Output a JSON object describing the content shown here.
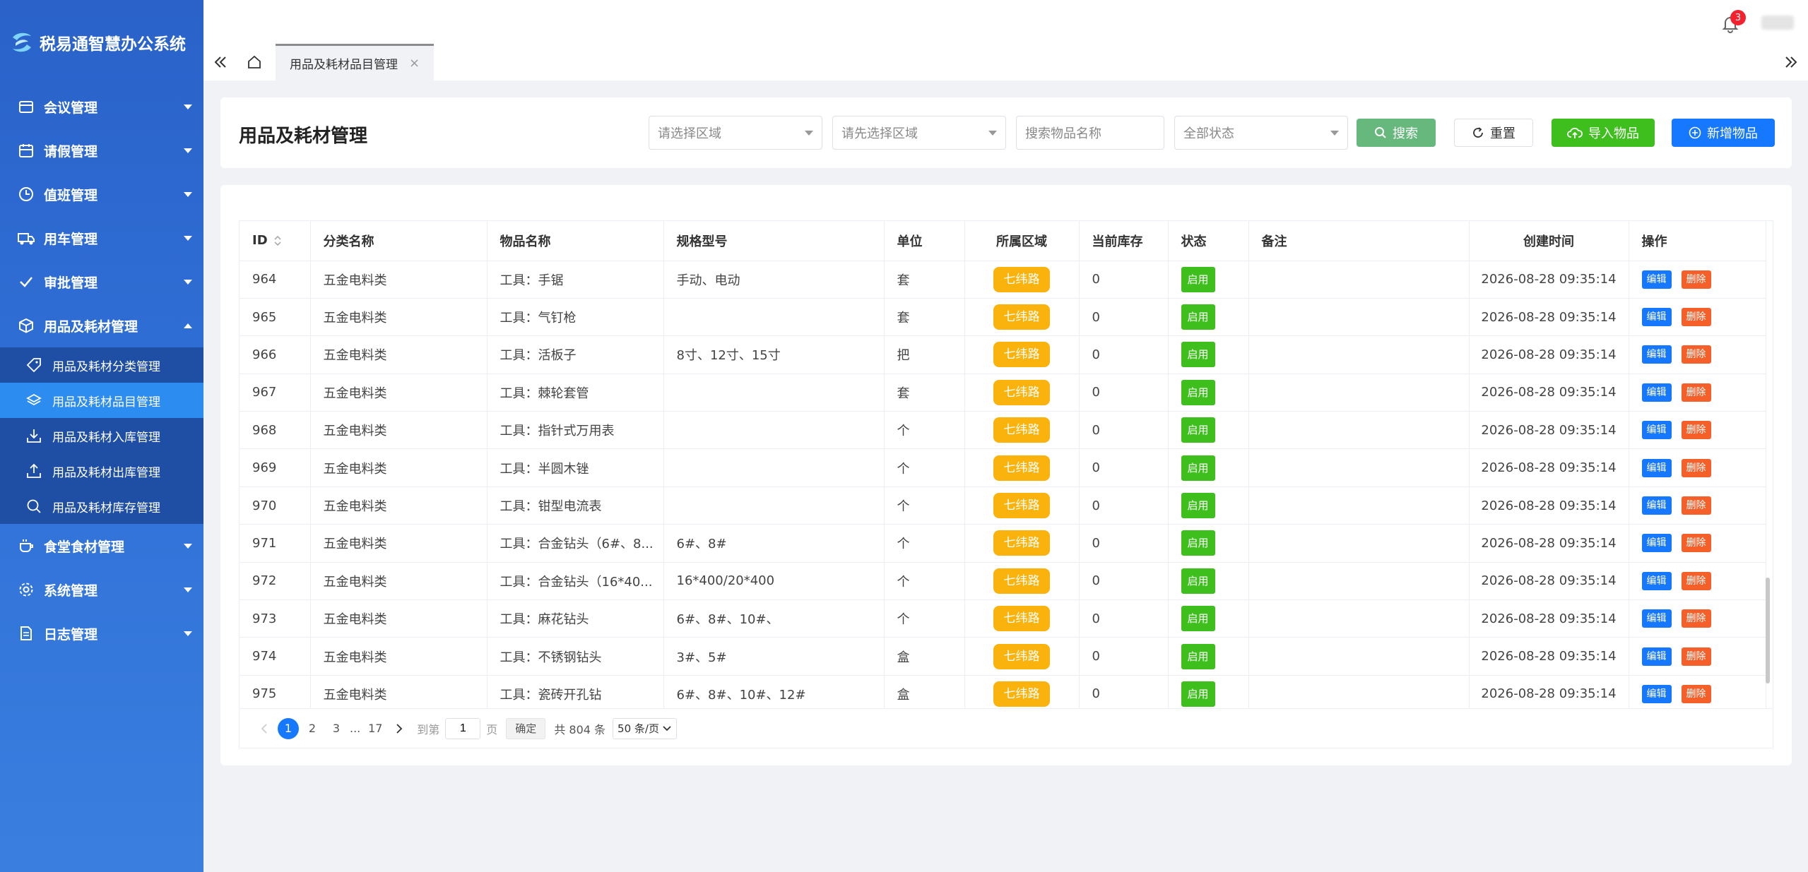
{
  "app": {
    "title": "税易通智慧办公系统"
  },
  "sidebar": {
    "items": [
      {
        "label": "会议管理",
        "icon": "calendar-icon"
      },
      {
        "label": "请假管理",
        "icon": "calendar-grid-icon"
      },
      {
        "label": "值班管理",
        "icon": "clock-icon"
      },
      {
        "label": "用车管理",
        "icon": "truck-icon"
      },
      {
        "label": "审批管理",
        "icon": "check-icon"
      },
      {
        "label": "用品及耗材管理",
        "icon": "box-icon"
      },
      {
        "label": "食堂食材管理",
        "icon": "cup-icon"
      },
      {
        "label": "系统管理",
        "icon": "gear-icon"
      },
      {
        "label": "日志管理",
        "icon": "document-icon"
      }
    ],
    "subitems": [
      {
        "label": "用品及耗材分类管理",
        "icon": "tag-icon"
      },
      {
        "label": "用品及耗材品目管理",
        "icon": "layers-icon"
      },
      {
        "label": "用品及耗材入库管理",
        "icon": "download-icon"
      },
      {
        "label": "用品及耗材出库管理",
        "icon": "upload-icon"
      },
      {
        "label": "用品及耗材库存管理",
        "icon": "search-icon"
      }
    ]
  },
  "header": {
    "notification_count": "3"
  },
  "tabs": [
    {
      "label": "用品及耗材品目管理"
    }
  ],
  "filters": {
    "page_title": "用品及耗材管理",
    "region1_placeholder": "请选择区域",
    "region2_placeholder": "请先选择区域",
    "search_placeholder": "搜索物品名称",
    "status_value": "全部状态",
    "search_label": "搜索",
    "reset_label": "重置",
    "import_label": "导入物品",
    "add_label": "新增物品"
  },
  "table": {
    "columns": [
      "ID",
      "分类名称",
      "物品名称",
      "规格型号",
      "单位",
      "所属区域",
      "当前库存",
      "状态",
      "备注",
      "创建时间",
      "操作"
    ],
    "edit_label": "编辑",
    "delete_label": "删除",
    "rows": [
      {
        "id": "964",
        "category": "五金电料类",
        "name": "工具：手锯",
        "spec": "手动、电动",
        "unit": "套",
        "area": "七纬路",
        "stock": "0",
        "status": "启用",
        "note": "",
        "created": "2026-08-28 09:35:14"
      },
      {
        "id": "965",
        "category": "五金电料类",
        "name": "工具：气钉枪",
        "spec": "",
        "unit": "套",
        "area": "七纬路",
        "stock": "0",
        "status": "启用",
        "note": "",
        "created": "2026-08-28 09:35:14"
      },
      {
        "id": "966",
        "category": "五金电料类",
        "name": "工具：活板子",
        "spec": "8寸、12寸、15寸",
        "unit": "把",
        "area": "七纬路",
        "stock": "0",
        "status": "启用",
        "note": "",
        "created": "2026-08-28 09:35:14"
      },
      {
        "id": "967",
        "category": "五金电料类",
        "name": "工具：棘轮套管",
        "spec": "",
        "unit": "套",
        "area": "七纬路",
        "stock": "0",
        "status": "启用",
        "note": "",
        "created": "2026-08-28 09:35:14"
      },
      {
        "id": "968",
        "category": "五金电料类",
        "name": "工具：指针式万用表",
        "spec": "",
        "unit": "个",
        "area": "七纬路",
        "stock": "0",
        "status": "启用",
        "note": "",
        "created": "2026-08-28 09:35:14"
      },
      {
        "id": "969",
        "category": "五金电料类",
        "name": "工具：半圆木锉",
        "spec": "",
        "unit": "个",
        "area": "七纬路",
        "stock": "0",
        "status": "启用",
        "note": "",
        "created": "2026-08-28 09:35:14"
      },
      {
        "id": "970",
        "category": "五金电料类",
        "name": "工具：钳型电流表",
        "spec": "",
        "unit": "个",
        "area": "七纬路",
        "stock": "0",
        "status": "启用",
        "note": "",
        "created": "2026-08-28 09:35:14"
      },
      {
        "id": "971",
        "category": "五金电料类",
        "name": "工具：合金钻头（6#、8...",
        "spec": "6#、8#",
        "unit": "个",
        "area": "七纬路",
        "stock": "0",
        "status": "启用",
        "note": "",
        "created": "2026-08-28 09:35:14"
      },
      {
        "id": "972",
        "category": "五金电料类",
        "name": "工具：合金钻头（16*40...",
        "spec": "16*400/20*400",
        "unit": "个",
        "area": "七纬路",
        "stock": "0",
        "status": "启用",
        "note": "",
        "created": "2026-08-28 09:35:14"
      },
      {
        "id": "973",
        "category": "五金电料类",
        "name": "工具：麻花钻头",
        "spec": "6#、8#、10#、",
        "unit": "个",
        "area": "七纬路",
        "stock": "0",
        "status": "启用",
        "note": "",
        "created": "2026-08-28 09:35:14"
      },
      {
        "id": "974",
        "category": "五金电料类",
        "name": "工具：不锈钢钻头",
        "spec": "3#、5#",
        "unit": "盒",
        "area": "七纬路",
        "stock": "0",
        "status": "启用",
        "note": "",
        "created": "2026-08-28 09:35:14"
      },
      {
        "id": "975",
        "category": "五金电料类",
        "name": "工具：瓷砖开孔钻",
        "spec": "6#、8#、10#、12#",
        "unit": "盒",
        "area": "七纬路",
        "stock": "0",
        "status": "启用",
        "note": "",
        "created": "2026-08-28 09:35:14"
      }
    ]
  },
  "pagination": {
    "pages": [
      "1",
      "2",
      "3"
    ],
    "ellipsis": "...",
    "last_page": "17",
    "goto_label": "到第",
    "goto_value": "1",
    "page_unit": "页",
    "confirm_label": "确定",
    "total_label": "共 804 条",
    "page_size": "50 条/页"
  },
  "colors": {
    "sidebar": "#2a62c9",
    "active": "#2d8cf0",
    "area_tag": "#fab30d",
    "status_tag": "#3fbf1d",
    "primary": "#1677ff",
    "danger": "#f5602a"
  }
}
